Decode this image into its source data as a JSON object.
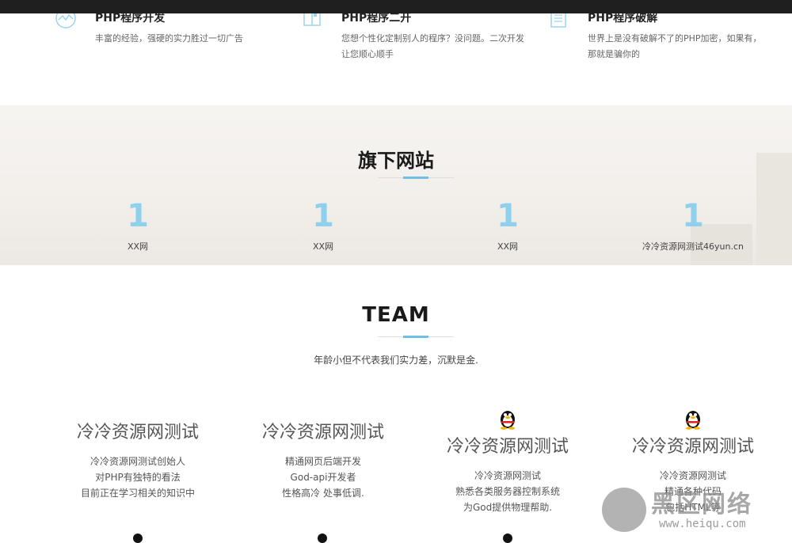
{
  "services": [
    {
      "icon": "chart-wave-icon",
      "title": "PHP程序开发",
      "desc": "丰富的经验，强硬的实力胜过一切广告"
    },
    {
      "icon": "book-icon",
      "title": "PHP程序二开",
      "desc": "您想个性化定制别人的程序？没问题。二次开发让您顺心顺手"
    },
    {
      "icon": "document-icon",
      "title": "PHP程序破解",
      "desc": "世界上是没有破解不了的PHP加密，如果有，那就是骗你的"
    }
  ],
  "sites": {
    "title": "旗下网站",
    "items": [
      {
        "num": "1",
        "label": "XX网"
      },
      {
        "num": "1",
        "label": "XX网"
      },
      {
        "num": "1",
        "label": "XX网"
      },
      {
        "num": "1",
        "label": "冷冷资源网测试46yun.cn"
      }
    ]
  },
  "team": {
    "title": "TEAM",
    "subtitle": "年龄小但不代表我们实力差，沉默是金.",
    "members": [
      {
        "name": "冷冷资源网测试",
        "avatar": false,
        "lines": [
          "冷冷资源网测试创始人",
          "对PHP有独特的看法",
          "目前正在学习相关的知识中"
        ]
      },
      {
        "name": "冷冷资源网测试",
        "avatar": false,
        "lines": [
          "精通网页后端开发",
          "God-api开发者",
          "性格高冷 处事低调."
        ]
      },
      {
        "name": "冷冷资源网测试",
        "avatar": true,
        "lines": [
          "冷冷资源网测试",
          "熟悉各类服务器控制系统",
          "为God提供物理帮助."
        ]
      },
      {
        "name": "冷冷资源网测试",
        "avatar": true,
        "lines": [
          "冷冷资源网测试",
          "精通各种代码",
          "包括HTML等"
        ]
      }
    ]
  },
  "watermark": {
    "text": "黑区网络",
    "url": "www.heiqu.com"
  },
  "colors": {
    "accent": "#6ec1e4",
    "stat": "#8fd0ec",
    "topbar": "#1f1f1f"
  }
}
